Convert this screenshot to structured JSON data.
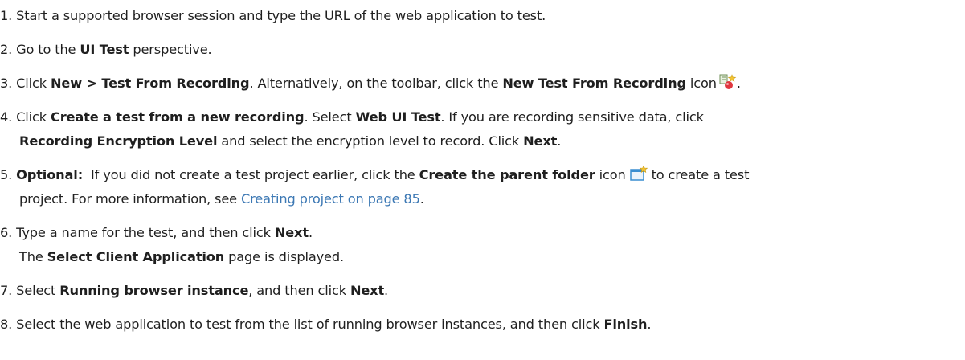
{
  "steps": [
    {
      "num": "1.",
      "text": "Start a supported browser session and type the URL of the web application to test."
    },
    {
      "num": "2.",
      "pre": "Go to the ",
      "b1": "UI Test",
      "post": " perspective."
    },
    {
      "num": "3.",
      "pre": "Click ",
      "b1": "New > Test From Recording",
      "mid": ". Alternatively, on the toolbar, click the ",
      "b2": "New Test From Recording",
      "post": " icon",
      "end": ".",
      "icon": "new-test-from-recording-icon"
    },
    {
      "num": "4.",
      "pre": "Click ",
      "b1": "Create a test from a new recording",
      "mid1": ". Select ",
      "b2": "Web UI Test",
      "mid2": ". If you are recording sensitive data, click",
      "b3": "Recording Encryption Level",
      "mid3": " and select the encryption level to record. Click ",
      "b4": "Next",
      "end": "."
    },
    {
      "num": "5.",
      "b1": "Optional:",
      "mid1": "  If you did not create a test project earlier, click the ",
      "b2": "Create the parent folder",
      "mid2": " icon ",
      "post": " to create a test",
      "cont": "project. For more information, see ",
      "link": "Creating project on page 85",
      "end": ".",
      "icon": "create-parent-folder-icon"
    },
    {
      "num": "6.",
      "pre": "Type a name for the test, and then click ",
      "b1": "Next",
      "end": ".",
      "cont_pre": "The ",
      "cont_b": "Select Client Application",
      "cont_post": " page is displayed."
    },
    {
      "num": "7.",
      "pre": "Select ",
      "b1": "Running browser instance",
      "mid": ", and then click ",
      "b2": "Next",
      "end": "."
    },
    {
      "num": "8.",
      "pre": "Select the web application to test from the list of running browser instances, and then click ",
      "b1": "Finish",
      "end": "."
    }
  ],
  "colors": {
    "text": "#1f1f1f",
    "link": "#3c78b4"
  }
}
